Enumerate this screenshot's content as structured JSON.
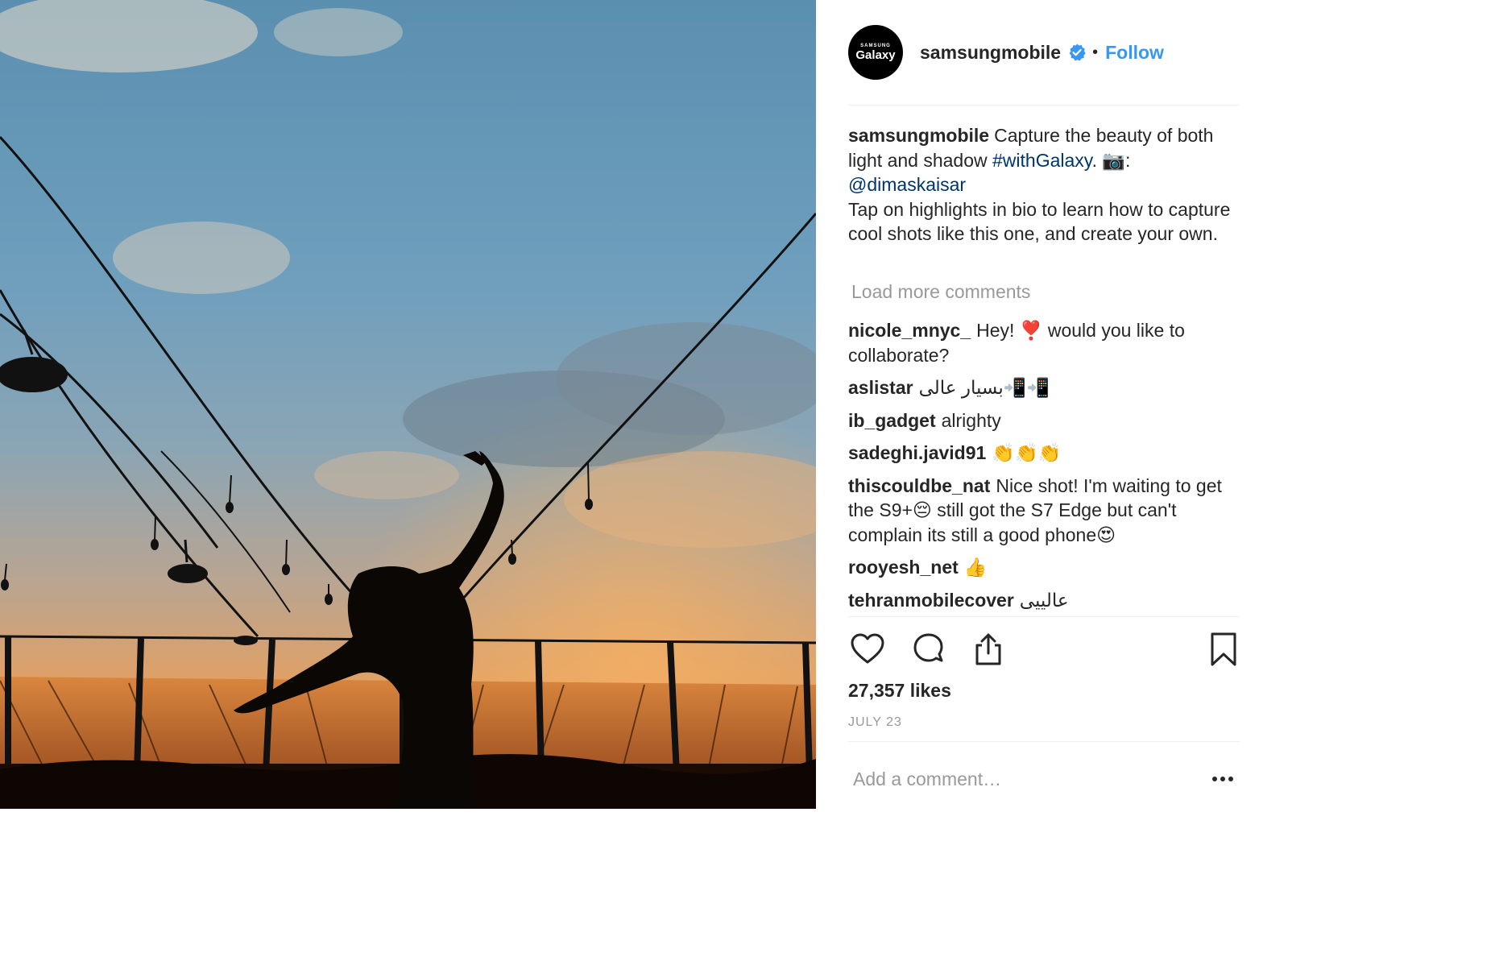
{
  "post": {
    "author": {
      "username": "samsungmobile",
      "avatar_brand_top": "SAMSUNG",
      "avatar_brand_main": "Galaxy",
      "verified": true,
      "follow_label": "Follow",
      "separator": "•"
    },
    "caption": {
      "username": "samsungmobile",
      "text_1": "Capture the beauty of both light and shadow",
      "hashtag": "#withGalaxy",
      "text_2": ". 📷:",
      "mention": "@dimaskaisar",
      "text_3": "Tap on highlights in bio to learn how to capture cool shots like this one, and create your own."
    },
    "load_more_label": "Load more comments",
    "comments": [
      {
        "username": "nicole_mnyc_",
        "text": "Hey! ❣️ would you like to collaborate?"
      },
      {
        "username": "aslistar",
        "text": "بسیار عالی📲📲"
      },
      {
        "username": "ib_gadget",
        "text": "alrighty"
      },
      {
        "username": "sadeghi.javid91",
        "text": "👏👏👏"
      },
      {
        "username": "thiscouldbe_nat",
        "text": "Nice shot! I'm waiting to get the S9+😔 still got the S7 Edge but can't complain its still a good phone😍"
      },
      {
        "username": "rooyesh_net",
        "text": "👍"
      },
      {
        "username": "tehranmobilecover",
        "text": "عالییی"
      }
    ],
    "likes_label": "27,357 likes",
    "date_label": "JULY 23",
    "comment_placeholder": "Add a comment…",
    "icons": {
      "like": "heart-icon",
      "comment": "comment-bubble-icon",
      "share": "share-icon",
      "save": "bookmark-icon",
      "more": "more-options-icon",
      "verified": "verified-badge-icon"
    },
    "colors": {
      "link": "#3897f0",
      "hashtag": "#003569",
      "muted": "#999999",
      "text": "#262626",
      "verified": "#3897f0"
    }
  }
}
